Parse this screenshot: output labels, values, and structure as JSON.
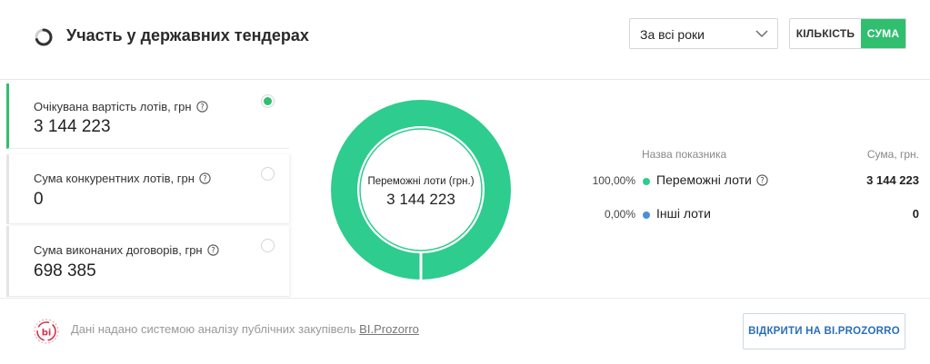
{
  "header": {
    "title": "Участь у державних тендерах",
    "year_select": {
      "value": "За всі роки"
    },
    "toggle": {
      "count_label": "КІЛЬКІСТЬ",
      "sum_label": "СУМА",
      "selected": "СУМА"
    }
  },
  "metrics": [
    {
      "label": "Очікувана вартість лотів, грн",
      "value": "3 144 223",
      "selected": true
    },
    {
      "label": "Сума конкурентних лотів, грн",
      "value": "0",
      "selected": false
    },
    {
      "label": "Сума виконаних договорів, грн",
      "value": "698 385",
      "selected": false
    }
  ],
  "donut": {
    "label": "Переможні лоти (грн.)",
    "value": "3 144 223",
    "segments": [
      {
        "name": "Переможні лоти",
        "share": 1.0,
        "color": "#2ecc8e"
      },
      {
        "name": "Інші лоти",
        "share": 0.0,
        "color": "#4a90d9"
      }
    ]
  },
  "table": {
    "col_name": "Назва показника",
    "col_sum": "Сума, грн.",
    "rows": [
      {
        "pct": "100,00%",
        "name": "Переможні лоти",
        "value": "3 144 223",
        "color": "#2ecc8e"
      },
      {
        "pct": "0,00%",
        "name": "Інші лоти",
        "value": "0",
        "color": "#4a90d9"
      }
    ]
  },
  "footer": {
    "text": "Дані надано системою аналізу публічних закупівель",
    "link": "BI.Prozorro",
    "button": "ВІДКРИТИ НА BI.PROZORRO",
    "logo_text": "bi"
  },
  "colors": {
    "accent_green": "#2fbf6f",
    "donut_green": "#2ecc8e",
    "link_blue": "#2a6fb8",
    "logo_red": "#d0314c"
  }
}
